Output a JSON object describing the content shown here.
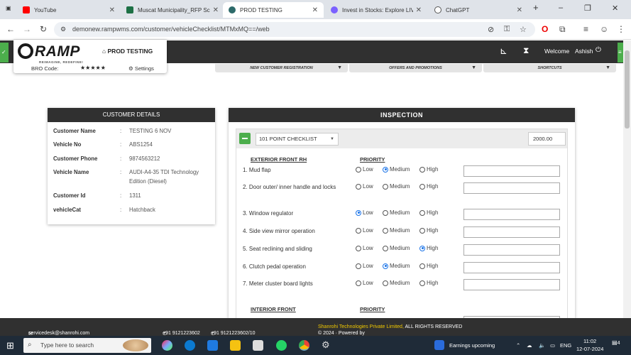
{
  "browser": {
    "tabs": [
      {
        "label": "YouTube",
        "color": "#ff0000",
        "active": false
      },
      {
        "label": "Muscat Municipality_RFP Scr",
        "color": "#1d7045",
        "active": false
      },
      {
        "label": "PROD TESTING",
        "color": "#2d6a6a",
        "active": true
      },
      {
        "label": "Invest in Stocks: Explore LIVE",
        "color": "#7b61ff",
        "active": false
      },
      {
        "label": "ChatGPT",
        "color": "#555555",
        "active": false
      }
    ],
    "url": "demonew.rampwms.com/customer/vehicleChecklist/MTMxMQ==/web"
  },
  "app": {
    "logo": "RAMP",
    "tagline": "REIMAGINE, REDEFINE!",
    "title": "PROD TESTING",
    "bro_code_label": "BRO Code:",
    "stars": "★★★★★",
    "settings_label": "Settings",
    "welcome": "Welcome",
    "user": "Ashish",
    "menu": [
      "NEW CUSTOMER REGISTRATION",
      "OFFERS AND PROMOTIONS",
      "SHORTCUTS"
    ]
  },
  "customer": {
    "header": "CUSTOMER DETAILS",
    "rows": [
      {
        "label": "Customer Name",
        "value": "TESTING 6 NOV"
      },
      {
        "label": "Vehicle No",
        "value": "ABS1254"
      },
      {
        "label": "Customer Phone",
        "value": "9874563212"
      },
      {
        "label": "Vehicle Name",
        "value": "AUDI-A4-35 TDI Technology Edition (Diesel)"
      },
      {
        "label": "Customer Id",
        "value": "1311"
      },
      {
        "label": "vehicleCat",
        "value": "Hatchback"
      }
    ]
  },
  "inspection": {
    "header": "INSPECTION",
    "checklist": "101 POINT CHECKLIST",
    "amount": "2000.00",
    "section1": "EXTERIOR FRONT RH",
    "priority_label": "PRIORITY",
    "section2": "INTERIOR FRONT",
    "priority_options": [
      "Low",
      "Medium",
      "High"
    ],
    "items": [
      {
        "label": "1. Mud flap",
        "priority": "Medium"
      },
      {
        "label": "2. Door outer/ inner handle and locks",
        "priority": ""
      },
      {
        "label": "3. Window regulator",
        "priority": "Low"
      },
      {
        "label": "4. Side view mirror operation",
        "priority": ""
      },
      {
        "label": "5. Seat reclining and sliding",
        "priority": "High"
      },
      {
        "label": "6. Clutch pedal operation",
        "priority": "Medium"
      },
      {
        "label": "7. Meter cluster board lights",
        "priority": ""
      }
    ]
  },
  "footer": {
    "email": "servicedesk@shanrohi.com",
    "phones": "+91 9121223602",
    "phones2": "+91 9121223602/10",
    "copyright": "© 2024 · Powered by",
    "company": "Shanrohi Technologies Private Limited,",
    "rights": "ALL RIGHTS RESERVED"
  },
  "taskbar": {
    "search_placeholder": "Type here to search",
    "news": "Earnings upcoming",
    "lang": "ENG",
    "time": "11:02",
    "date": "12-07-2024",
    "notif": "4"
  }
}
